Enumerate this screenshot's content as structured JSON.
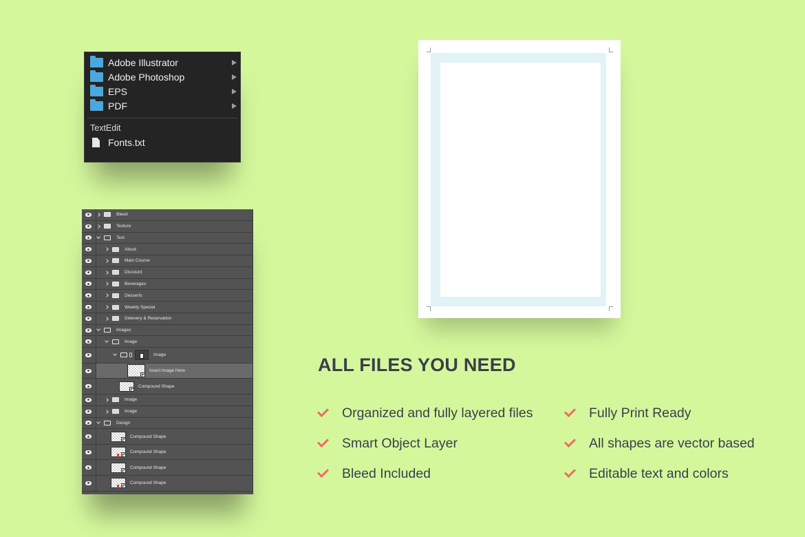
{
  "finder": {
    "folders": [
      {
        "label": "Adobe Illustrator",
        "icon": "folder-icon",
        "color": "#4aa8df"
      },
      {
        "label": "Adobe Photoshop",
        "icon": "folder-icon",
        "color": "#4aa8df"
      },
      {
        "label": "EPS",
        "icon": "folder-icon",
        "color": "#4aa8df"
      },
      {
        "label": "PDF",
        "icon": "folder-icon",
        "color": "#4aa8df"
      }
    ],
    "section_label": "TextEdit",
    "file_label": "Fonts.txt"
  },
  "layers": [
    {
      "label": "Bleed",
      "kind": "group",
      "state": "closed",
      "depth": 0
    },
    {
      "label": "Texture",
      "kind": "group",
      "state": "closed",
      "depth": 0
    },
    {
      "label": "Text",
      "kind": "group",
      "state": "open",
      "depth": 0
    },
    {
      "label": "About",
      "kind": "group",
      "state": "closed",
      "depth": 1
    },
    {
      "label": "Main Course",
      "kind": "group",
      "state": "closed",
      "depth": 1
    },
    {
      "label": "Discount",
      "kind": "group",
      "state": "closed",
      "depth": 1
    },
    {
      "label": "Beverages",
      "kind": "group",
      "state": "closed",
      "depth": 1
    },
    {
      "label": "Desserts",
      "kind": "group",
      "state": "closed",
      "depth": 1
    },
    {
      "label": "Weekly Special",
      "kind": "group",
      "state": "closed",
      "depth": 1
    },
    {
      "label": "Delevery & Reservation",
      "kind": "group",
      "state": "closed",
      "depth": 1
    },
    {
      "label": "Images",
      "kind": "group",
      "state": "open",
      "depth": 0
    },
    {
      "label": "Image",
      "kind": "group",
      "state": "open",
      "depth": 1
    },
    {
      "label": "Image",
      "kind": "masked-group",
      "state": "open",
      "depth": 2
    },
    {
      "label": "Insert Image Here",
      "kind": "smart-object",
      "depth": 3,
      "selected": true
    },
    {
      "label": "Compound Shape",
      "kind": "shape",
      "depth": 2
    },
    {
      "label": "Image",
      "kind": "group",
      "state": "closed",
      "depth": 1
    },
    {
      "label": "Image",
      "kind": "group",
      "state": "closed",
      "depth": 1
    },
    {
      "label": "Design",
      "kind": "group",
      "state": "open",
      "depth": 0
    },
    {
      "label": "Compound Shape",
      "kind": "shape",
      "depth": 1
    },
    {
      "label": "Compound Shape",
      "kind": "shape",
      "depth": 1,
      "red": true
    },
    {
      "label": "Compound Shape",
      "kind": "shape",
      "depth": 1
    },
    {
      "label": "Compound Shape",
      "kind": "shape",
      "depth": 1,
      "red": true
    }
  ],
  "preview": {
    "bleed_color": "#e1f3f7",
    "page_color": "#ffffff"
  },
  "features": {
    "title": "ALL FILES YOU NEED",
    "left": [
      "Organized and fully layered files",
      "Smart Object Layer",
      "Bleed Included"
    ],
    "right": [
      "Fully Print Ready",
      "All shapes are vector based",
      "Editable text and colors"
    ],
    "check_color": "#ef6b60"
  },
  "colors": {
    "background": "#d4f79c",
    "panel_dark": "#242424",
    "layers_bg": "#535353",
    "text_dark": "#3a3f4a"
  }
}
